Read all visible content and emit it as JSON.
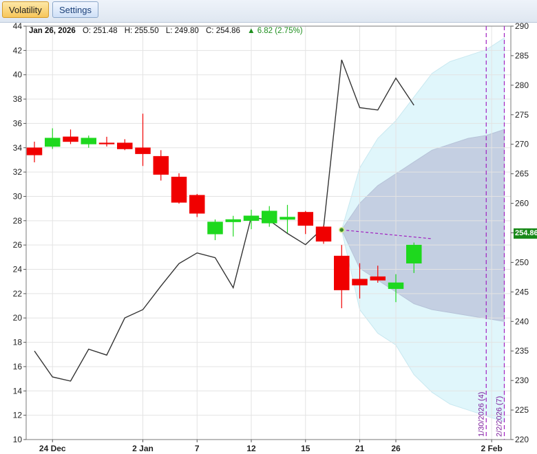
{
  "toolbar": {
    "tabs": [
      {
        "label": "Volatility",
        "active": true
      },
      {
        "label": "Settings",
        "active": false
      }
    ]
  },
  "info": {
    "date": "Jan 26, 2026",
    "open_label": "O:",
    "open": "251.48",
    "high_label": "H:",
    "high": "255.50",
    "low_label": "L:",
    "low": "249.80",
    "close_label": "C:",
    "close": "254.86",
    "change_arrow": "▲",
    "change": "6.82 (2.75%)"
  },
  "last_price_label": "254.86",
  "colors": {
    "up": "#1ed81e",
    "down": "#f00000",
    "line": "#333333",
    "band_outer": "#e0f6fb",
    "band_inner": "#c4cfe2",
    "vline": "#a020c0",
    "price_tag": "#1a8a1a"
  },
  "chart_data": {
    "type": "candlestick",
    "left_axis": {
      "ticks": [
        10,
        12,
        14,
        16,
        18,
        20,
        22,
        24,
        26,
        28,
        30,
        32,
        34,
        36,
        38,
        40,
        42,
        44
      ],
      "range": [
        10,
        44
      ]
    },
    "right_axis": {
      "ticks": [
        220,
        225,
        230,
        235,
        240,
        245,
        250,
        255,
        260,
        265,
        270,
        275,
        280,
        285,
        290
      ],
      "range": [
        220,
        290
      ]
    },
    "x_axis": {
      "ticks": [
        {
          "label": "24 Dec",
          "idx": 1
        },
        {
          "label": "2 Jan",
          "idx": 6
        },
        {
          "label": "7",
          "idx": 9
        },
        {
          "label": "12",
          "idx": 12
        },
        {
          "label": "15",
          "idx": 15
        },
        {
          "label": "21",
          "idx": 18
        },
        {
          "label": "26",
          "idx": 20
        },
        {
          "label": "2 Feb",
          "idx": 25.3
        }
      ]
    },
    "candles": [
      {
        "o": 34.0,
        "h": 34.5,
        "l": 32.8,
        "c": 33.4
      },
      {
        "o": 34.1,
        "h": 35.6,
        "l": 33.9,
        "c": 34.8
      },
      {
        "o": 34.9,
        "h": 35.5,
        "l": 34.3,
        "c": 34.5
      },
      {
        "o": 34.3,
        "h": 35.0,
        "l": 34.0,
        "c": 34.8
      },
      {
        "o": 34.4,
        "h": 34.9,
        "l": 34.1,
        "c": 34.3
      },
      {
        "o": 34.4,
        "h": 34.7,
        "l": 33.8,
        "c": 33.9
      },
      {
        "o": 34.0,
        "h": 36.8,
        "l": 32.5,
        "c": 33.5
      },
      {
        "o": 33.3,
        "h": 33.8,
        "l": 31.3,
        "c": 31.8
      },
      {
        "o": 31.6,
        "h": 31.9,
        "l": 29.4,
        "c": 29.5
      },
      {
        "o": 30.1,
        "h": 30.2,
        "l": 28.3,
        "c": 28.6
      },
      {
        "o": 26.9,
        "h": 28.1,
        "l": 26.4,
        "c": 27.9
      },
      {
        "o": 27.9,
        "h": 28.4,
        "l": 26.7,
        "c": 28.1
      },
      {
        "o": 28.0,
        "h": 28.9,
        "l": 27.3,
        "c": 28.4
      },
      {
        "o": 27.8,
        "h": 29.2,
        "l": 27.5,
        "c": 28.8
      },
      {
        "o": 28.1,
        "h": 29.3,
        "l": 27.0,
        "c": 28.3
      },
      {
        "o": 28.7,
        "h": 28.8,
        "l": 26.9,
        "c": 27.6
      },
      {
        "o": 27.5,
        "h": 27.6,
        "l": 26.1,
        "c": 26.3
      },
      {
        "o": 25.1,
        "h": 26.0,
        "l": 20.8,
        "c": 22.3
      },
      {
        "o": 23.2,
        "h": 24.5,
        "l": 21.6,
        "c": 22.7
      },
      {
        "o": 23.4,
        "h": 24.3,
        "l": 22.9,
        "c": 23.1
      },
      {
        "o": 22.4,
        "h": 23.6,
        "l": 21.3,
        "c": 22.9
      },
      {
        "o": 24.5,
        "h": 26.2,
        "l": 23.7,
        "c": 26.0
      }
    ],
    "volatility_line": {
      "idx": [
        0,
        1,
        2,
        3,
        4,
        5,
        6,
        7,
        8,
        9,
        10,
        11,
        12,
        13,
        14,
        15,
        16,
        17,
        18,
        19,
        20,
        21
      ],
      "values": [
        235.0,
        230.6,
        229.9,
        235.3,
        234.3,
        240.6,
        242.0,
        246.0,
        249.8,
        251.6,
        250.8,
        245.7,
        257.7,
        257.1,
        254.9,
        253.0,
        255.9,
        284.3,
        276.2,
        275.8,
        281.2,
        276.6
      ]
    },
    "projection": {
      "idx": [
        17,
        18,
        19,
        20,
        21,
        22,
        23,
        24,
        25,
        26
      ],
      "outer_upper": [
        255.5,
        266,
        271,
        274,
        278,
        282,
        284,
        285,
        286,
        288
      ],
      "outer_lower": [
        255.5,
        242,
        238,
        236,
        231,
        228,
        226,
        225,
        224,
        223
      ],
      "inner_upper": [
        255.5,
        260,
        263,
        265,
        267,
        269,
        270,
        271,
        271.5,
        272.5
      ],
      "inner_lower": [
        255.5,
        249,
        247,
        245,
        243,
        242,
        241.5,
        241,
        240.5,
        240
      ],
      "dashed_line_from": {
        "idx": 17,
        "value": 255.5
      },
      "dashed_line_to": {
        "idx": 22,
        "value": 254.0
      }
    },
    "expirations": [
      {
        "label": "1/30/2026 (4)",
        "idx": 25.0
      },
      {
        "label": "2/2/2026 (7)",
        "idx": 26.0
      }
    ]
  }
}
